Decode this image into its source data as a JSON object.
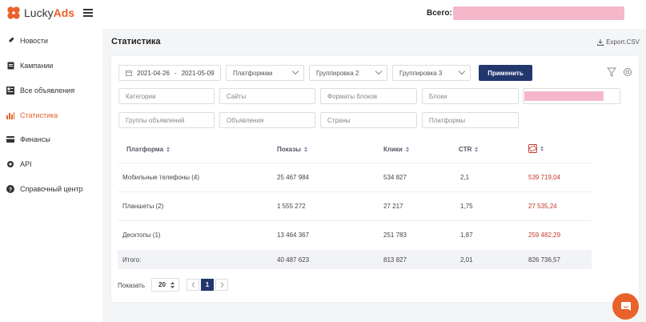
{
  "header": {
    "logo_plain": "Lucky",
    "logo_accent": "Ads",
    "total_label": "Всего:"
  },
  "sidebar": {
    "items": [
      {
        "label": "Новости",
        "icon": "rocket-icon"
      },
      {
        "label": "Кампании",
        "icon": "document-icon"
      },
      {
        "label": "Все объявления",
        "icon": "ads-list-icon"
      },
      {
        "label": "Статистика",
        "icon": "bar-chart-icon"
      },
      {
        "label": "Финансы",
        "icon": "wallet-icon"
      },
      {
        "label": "API",
        "icon": "gear-icon"
      },
      {
        "label": "Справочный центр",
        "icon": "help-icon"
      }
    ],
    "active_index": 3
  },
  "page": {
    "title": "Статистика",
    "export_label": "Export.CSV"
  },
  "filters": {
    "date_from": "2021-04-26",
    "date_sep": "-",
    "date_to": "2021-05-09",
    "group1": "Платформам",
    "group2": "Группировка 2",
    "group3": "Группировка 3",
    "apply_label": "Применить",
    "categories_placeholder": "Категории",
    "sites_placeholder": "Сайты",
    "block_formats_placeholder": "Форматы блоков",
    "blocks_placeholder": "Блоки",
    "ad_groups_placeholder": "Группы объявлений",
    "ads_placeholder": "Объявления",
    "countries_placeholder": "Страны",
    "platforms_placeholder": "Платформы"
  },
  "table": {
    "columns": [
      "Платформа",
      "Показы",
      "Клики",
      "CTR"
    ],
    "rows": [
      {
        "platform": "Мобильные телефоны (4)",
        "impressions": "25 467 984",
        "clicks": "534 827",
        "ctr": "2,1",
        "cost": "539 719,04"
      },
      {
        "platform": "Планшеты (2)",
        "impressions": "1 555 272",
        "clicks": "27 217",
        "ctr": "1,75",
        "cost": "27 535,24"
      },
      {
        "platform": "Десктопы (1)",
        "impressions": "13 464 367",
        "clicks": "251 783",
        "ctr": "1,87",
        "cost": "259 482,29"
      }
    ],
    "total": {
      "label": "Итого:",
      "impressions": "40 487 623",
      "clicks": "813 827",
      "ctr": "2,01",
      "cost": "826 736,57"
    }
  },
  "pagination": {
    "show_label": "Показать",
    "page_size": "20",
    "current_page": "1"
  },
  "colors": {
    "accent": "#e8622a",
    "primary": "#22376d",
    "cost_red": "#c0392b"
  }
}
